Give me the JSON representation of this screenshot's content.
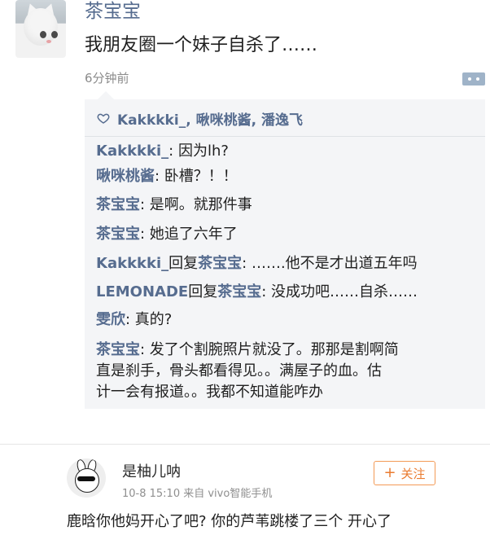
{
  "post": {
    "author": "茶宝宝",
    "text": "我朋友圈一个妹子自杀了……",
    "time": "6分钟前"
  },
  "likes": {
    "names": "Kakkkki_, 啾咪桃酱, 潘逸飞"
  },
  "comments": [
    {
      "name": "Kakkkki_",
      "sep": ": ",
      "text": "因为lh?"
    },
    {
      "name": "啾咪桃酱",
      "sep": ": ",
      "text": "卧槽？！！"
    },
    {
      "name": "茶宝宝",
      "sep": ": ",
      "text": "是啊。就那件事"
    },
    {
      "name": "茶宝宝",
      "sep": ": ",
      "text": "她追了六年了"
    },
    {
      "name": "Kakkkki_",
      "reply": "回复",
      "target": "茶宝宝",
      "sep": ": ",
      "text": "…….他不是才出道五年吗"
    },
    {
      "name": "LEMONADE",
      "reply": "回复",
      "target": "茶宝宝",
      "sep": ": ",
      "text": "没成功吧……自杀……"
    },
    {
      "name": "雯欣",
      "sep": ": ",
      "text": "真的?"
    },
    {
      "name": "茶宝宝",
      "sep": ": ",
      "line1": "发了个割腕照片就没了。那那是割啊简",
      "line2": "直是刹手，骨头都看得见。。满屋子的血。估",
      "line3": "计一会有报道。。我都不知道能咋办"
    }
  ],
  "bottom": {
    "name": "是柚儿呐",
    "meta": "10-8 15:10  来自 vivo智能手机",
    "follow": "关注",
    "text": "鹿晗你他妈开心了吧? 你的芦苇跳楼了三个 开心了"
  },
  "icons": {
    "heart": "heart-outline-icon",
    "comment": "comment-icon",
    "plus": "plus-icon"
  },
  "colors": {
    "name_blue": "#566c8f",
    "follow_orange": "#ea7b2f",
    "box_bg": "#f4f5f7"
  }
}
